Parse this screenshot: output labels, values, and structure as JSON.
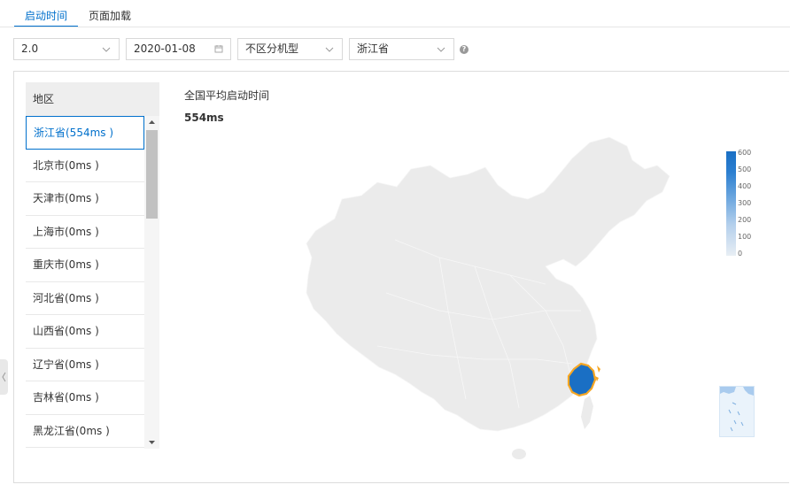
{
  "tabs": [
    {
      "label": "启动时间",
      "active": true
    },
    {
      "label": "页面加载",
      "active": false
    }
  ],
  "filters": {
    "version": "2.0",
    "date": "2020-01-08",
    "device": "不区分机型",
    "province": "浙江省",
    "help_glyph": "?"
  },
  "region": {
    "header": "地区",
    "items": [
      {
        "label": "浙江省(554ms )",
        "active": true
      },
      {
        "label": "北京市(0ms )"
      },
      {
        "label": "天津市(0ms )"
      },
      {
        "label": "上海市(0ms )"
      },
      {
        "label": "重庆市(0ms )"
      },
      {
        "label": "河北省(0ms )"
      },
      {
        "label": "山西省(0ms )"
      },
      {
        "label": "辽宁省(0ms )"
      },
      {
        "label": "吉林省(0ms )"
      },
      {
        "label": "黑龙江省(0ms )"
      }
    ]
  },
  "map": {
    "title": "全国平均启动时间",
    "value": "554ms",
    "highlight_color": "#1a6fc4",
    "highlight_border": "#f5a623",
    "base_color": "#ebebeb"
  },
  "legend": {
    "ticks": [
      "600",
      "500",
      "400",
      "300",
      "200",
      "100",
      "0"
    ]
  },
  "colors": {
    "accent": "#0070cc"
  }
}
